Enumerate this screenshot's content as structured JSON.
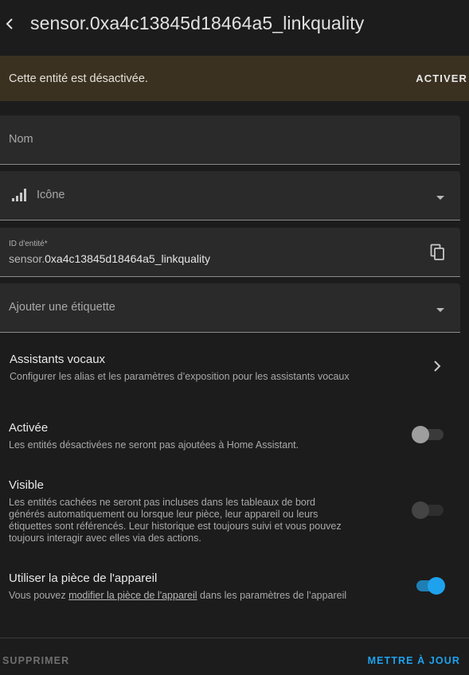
{
  "header": {
    "title": "sensor.0xa4c13845d18464a5_linkquality",
    "back_icon": "chevron-left-icon"
  },
  "banner": {
    "text": "Cette entité est désactivée.",
    "action_label": "ACTIVER",
    "background": "#3a3121"
  },
  "fields": {
    "name": {
      "placeholder": "Nom"
    },
    "icon": {
      "placeholder": "Icône",
      "icon": "signal-bars-icon"
    },
    "entity_id": {
      "label": "ID d'entité*",
      "prefix": "sensor.",
      "value": "0xa4c13845d18464a5_linkquality",
      "copy_icon": "copy-icon"
    },
    "labels": {
      "placeholder": "Ajouter une étiquette"
    }
  },
  "voice_assistants": {
    "title": "Assistants vocaux",
    "description": "Configurer les alias et les paramètres d’exposition pour les assistants vocaux"
  },
  "enabled": {
    "title": "Activée",
    "description": "Les entités désactivées ne seront pas ajoutées à Home Assistant.",
    "state": false
  },
  "visible": {
    "title": "Visible",
    "description_lines": [
      "Les entités cachées ne seront pas incluses dans les tableaux de bord",
      "générés automatiquement ou lorsque leur pièce, leur appareil ou leurs",
      "étiquettes sont référencés. Leur historique est toujours suivi et vous pouvez",
      "toujours interagir avec elles via des actions."
    ],
    "state": false
  },
  "device_area": {
    "title": "Utiliser la pièce de l'appareil",
    "description_before": "Vous pouvez ",
    "link_text": "modifier la pièce de l'appareil",
    "description_after": " dans les paramètres de l’appareil",
    "state": true
  },
  "footer": {
    "delete_label": "SUPPRIMER",
    "update_label": "METTRE À JOUR"
  },
  "colors": {
    "accent": "#1ea2ee",
    "background": "#1c1c1c",
    "field": "#2a2a2a"
  }
}
